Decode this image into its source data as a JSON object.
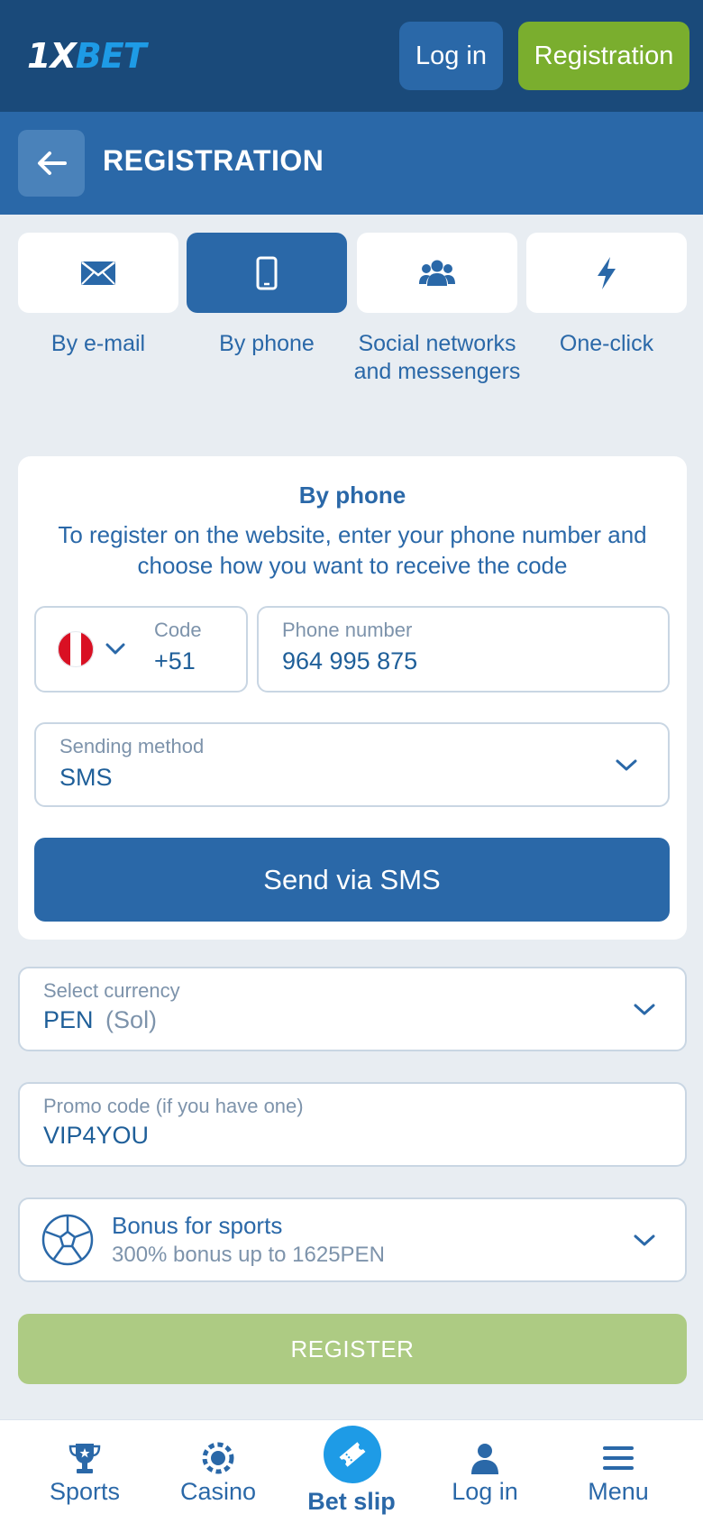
{
  "header": {
    "logo_part1": "1X",
    "logo_part2": "BET",
    "login_label": "Log in",
    "registration_label": "Registration"
  },
  "subheader": {
    "title": "REGISTRATION",
    "back_icon": "arrow-left-icon"
  },
  "methods": [
    {
      "label": "By e-mail",
      "icon": "envelope-icon",
      "active": false
    },
    {
      "label": "By phone",
      "icon": "phone-icon",
      "active": true
    },
    {
      "label": "Social networks and messengers",
      "icon": "users-icon",
      "active": false
    },
    {
      "label": "One-click",
      "icon": "lightning-icon",
      "active": false
    }
  ],
  "form": {
    "title": "By phone",
    "description": "To register on the website, enter your phone number and choose how you want to receive the code",
    "country_flag": "peru-flag",
    "code_label": "Code",
    "code_value": "+51",
    "phone_label": "Phone number",
    "phone_value": "964 995 875",
    "sending_label": "Sending method",
    "sending_value": "SMS",
    "send_button": "Send via SMS"
  },
  "currency": {
    "label": "Select currency",
    "value": "PEN",
    "value_note": "(Sol)"
  },
  "promo": {
    "label": "Promo code (if you have one)",
    "value": "VIP4YOU"
  },
  "bonus": {
    "title": "Bonus for sports",
    "subtitle": "300% bonus up to 1625PEN",
    "icon": "soccer-ball-icon"
  },
  "register_button": "REGISTER",
  "bottom_nav": {
    "sports": "Sports",
    "casino": "Casino",
    "betslip": "Bet slip",
    "login": "Log in",
    "menu": "Menu"
  },
  "colors": {
    "header_bg": "#1a4a7a",
    "primary": "#2a68a8",
    "registration_green": "#7aae2e",
    "register_disabled": "#adcb83",
    "accent_blue": "#1e9be6"
  }
}
